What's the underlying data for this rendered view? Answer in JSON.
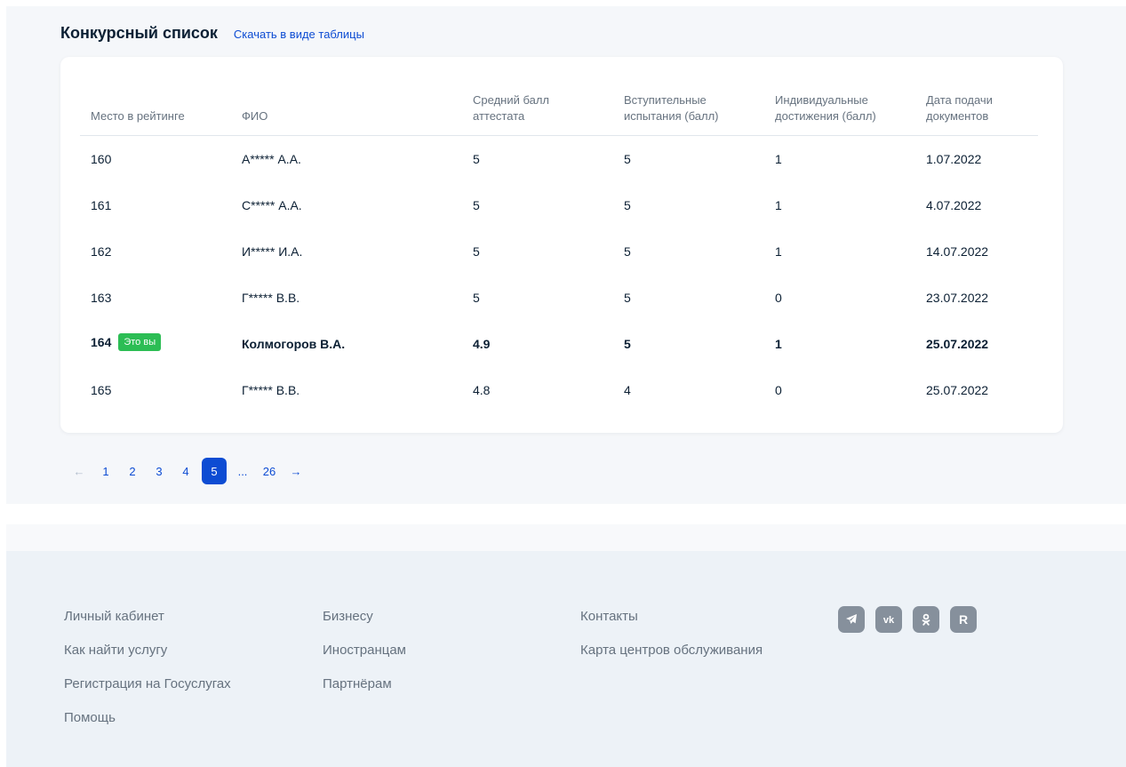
{
  "section": {
    "title": "Конкурсный список",
    "download_link": "Скачать в виде таблицы"
  },
  "table": {
    "headers": {
      "rank": "Место в рейтинге",
      "name": "ФИО",
      "avg_line1": "Средний балл",
      "avg_line2": "аттестата",
      "exam_line1": "Вступительные",
      "exam_line2": "испытания (балл)",
      "ach_line1": "Индивидуальные",
      "ach_line2": "достижения (балл)",
      "date_line1": "Дата подачи",
      "date_line2": "документов"
    },
    "rows": [
      {
        "rank": "160",
        "name": "А***** А.А.",
        "avg": "5",
        "exam": "5",
        "ach": "1",
        "date": "1.07.2022"
      },
      {
        "rank": "161",
        "name": "С***** А.А.",
        "avg": "5",
        "exam": "5",
        "ach": "1",
        "date": "4.07.2022"
      },
      {
        "rank": "162",
        "name": "И***** И.А.",
        "avg": "5",
        "exam": "5",
        "ach": "1",
        "date": "14.07.2022"
      },
      {
        "rank": "163",
        "name": "Г***** В.В.",
        "avg": "5",
        "exam": "5",
        "ach": "0",
        "date": "23.07.2022"
      },
      {
        "rank": "164",
        "badge": "Это вы",
        "name": "Колмогоров В.А.",
        "avg": "4.9",
        "exam": "5",
        "ach": "1",
        "date": "25.07.2022"
      },
      {
        "rank": "165",
        "name": "Г***** В.В.",
        "avg": "4.8",
        "exam": "4",
        "ach": "0",
        "date": "25.07.2022"
      }
    ]
  },
  "pagination": {
    "prev": "←",
    "pages": [
      "1",
      "2",
      "3",
      "4",
      "5"
    ],
    "current": "5",
    "ellipsis": "...",
    "last": "26",
    "next": "→"
  },
  "footer": {
    "col1": [
      "Личный кабинет",
      "Как найти услугу",
      "Регистрация на Госуслугах",
      "Помощь"
    ],
    "col2": [
      "Бизнесу",
      "Иностранцам",
      "Партнёрам"
    ],
    "col3": [
      "Контакты",
      "Карта центров обслуживания"
    ],
    "socials": [
      "telegram-icon",
      "vk-icon",
      "odnoklassniki-icon",
      "rutube-icon"
    ]
  },
  "colors": {
    "accent": "#0d4cd3",
    "badge": "#2cbd54",
    "social_bg": "#86909c",
    "footer_bg": "#edf2f7",
    "page_bg": "#f5f7fa"
  }
}
